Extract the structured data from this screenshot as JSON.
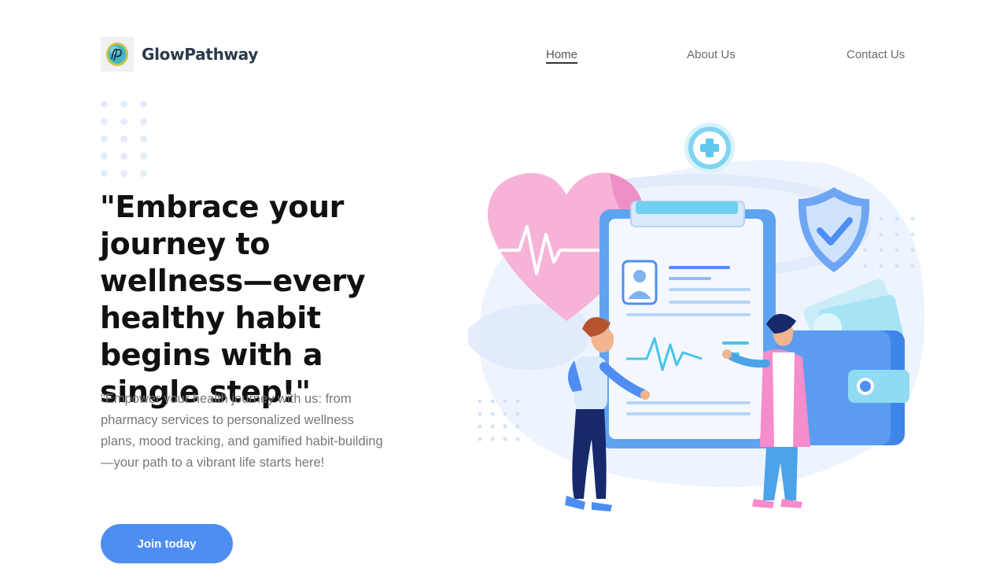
{
  "brand": {
    "name": "GlowPathway",
    "logo_initials": "GP"
  },
  "nav": {
    "home": "Home",
    "about": "About Us",
    "contact": "Contact Us"
  },
  "hero": {
    "headline": "\"Embrace your journey to wellness—every healthy habit begins with a single step!\"",
    "subtext": "\"Empower your health journey with us: from pharmacy services to personalized wellness plans, mood tracking, and gamified habit-building—your path to a vibrant life starts here!",
    "cta_label": "Join today"
  },
  "illustration": {
    "icons": [
      "heart-rate-icon",
      "medical-cross-icon",
      "shield-check-icon",
      "clipboard-icon",
      "wallet-icon"
    ]
  },
  "colors": {
    "accent": "#4e8ef2",
    "brand_text": "#2b3a4a",
    "heart_pink": "#f6a8d3",
    "clipboard_blue": "#5ea3f0"
  }
}
